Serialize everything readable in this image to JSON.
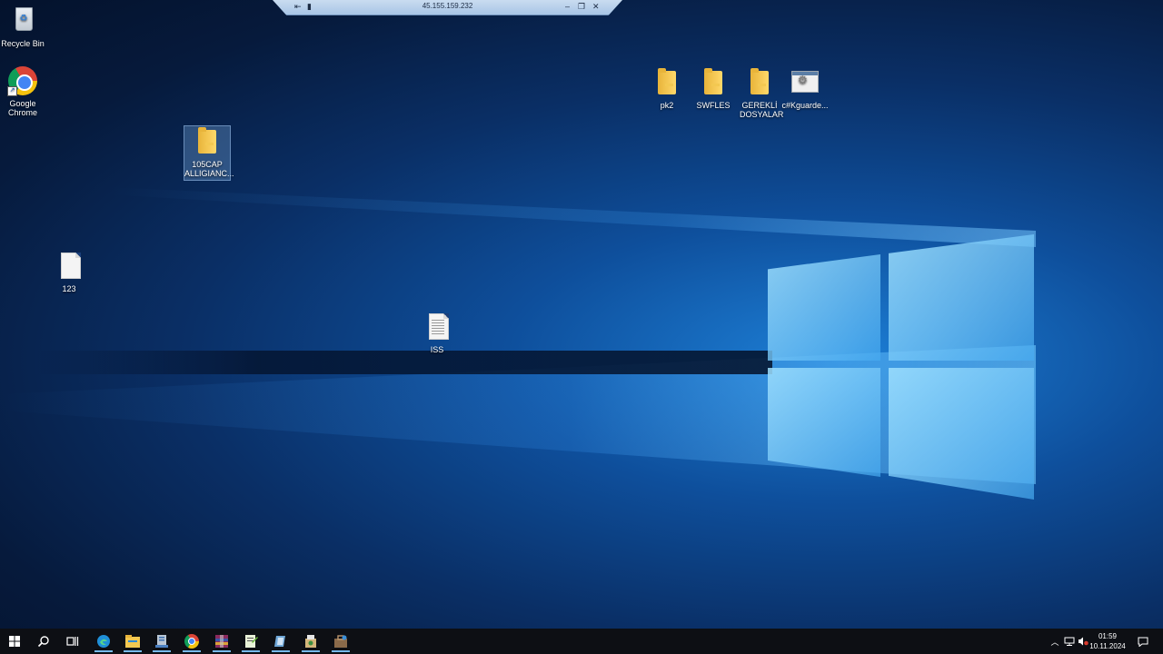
{
  "rdp_bar": {
    "host": "45.155.159.232"
  },
  "desktop_icons": [
    {
      "label": "Recycle Bin"
    },
    {
      "label": "Google Chrome"
    },
    {
      "label": "105CAP ALLIGIANC..."
    },
    {
      "label": "123"
    },
    {
      "label": "ISS"
    },
    {
      "label": "pk2"
    },
    {
      "label": "SWFLES"
    },
    {
      "label": "GEREKLİ DOSYALAR"
    },
    {
      "label": "c#Kguarde..."
    }
  ],
  "clock": {
    "time": "01:59",
    "date": "10.11.2024"
  },
  "colors": {
    "taskbar": "#0d0f14",
    "accent": "#76b9ed",
    "folder": "#ffd86a"
  }
}
